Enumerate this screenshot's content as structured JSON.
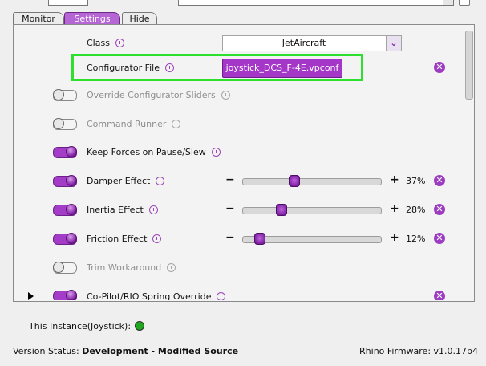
{
  "tabs": [
    {
      "label": "Monitor"
    },
    {
      "label": "Settings"
    },
    {
      "label": "Hide"
    }
  ],
  "settings": {
    "class_label": "Class",
    "class_value": "JetAircraft",
    "configurator_label": "Configurator File",
    "configurator_file": "joystick_DCS_F-4E.vpconf",
    "rows": [
      {
        "label": "Override Configurator Sliders",
        "enabled": false
      },
      {
        "label": "Command Runner",
        "enabled": false
      },
      {
        "label": "Keep Forces on Pause/Slew",
        "enabled": true
      },
      {
        "label": "Damper Effect",
        "enabled": true,
        "value": 37,
        "display": "37%"
      },
      {
        "label": "Inertia Effect",
        "enabled": true,
        "value": 28,
        "display": "28%"
      },
      {
        "label": "Friction Effect",
        "enabled": true,
        "value": 12,
        "display": "12%"
      },
      {
        "label": "Trim Workaround",
        "enabled": false
      },
      {
        "label": "Co-Pilot/RIO Spring Override",
        "enabled": true
      }
    ]
  },
  "glyphs": {
    "minus": "−",
    "plus": "+",
    "close": "✕",
    "dropdown": "⌄"
  },
  "footer": {
    "instance_label": "This Instance(Joystick):",
    "instance_status_color": "#1fa81f",
    "version_label": "Version Status:",
    "version_value": "Development - Modified Source",
    "firmware": "Rhino Firmware: v1.0.17b4"
  },
  "colors": {
    "accent": "#a437c8",
    "highlight": "#2ee02e"
  }
}
